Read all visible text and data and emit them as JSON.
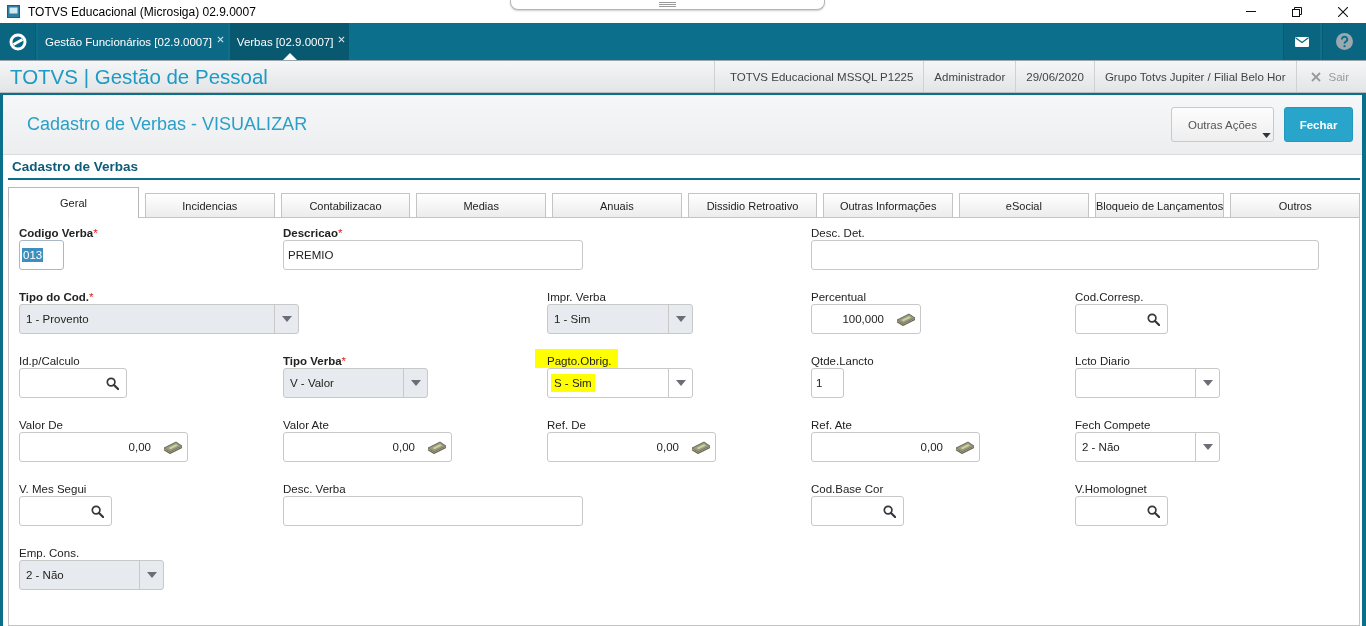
{
  "window": {
    "title": "TOTVS Educacional (Microsiga) 02.9.0007"
  },
  "app_tabs": [
    {
      "label": "Gestão Funcionários [02.9.0007]",
      "selected": false
    },
    {
      "label": "Verbas [02.9.0007]",
      "selected": true
    }
  ],
  "header": {
    "title": "TOTVS | Gestão de Pessoal",
    "info": [
      "TOTVS Educacional MSSQL P1225",
      "Administrador",
      "29/06/2020",
      "Grupo Totvs Jupiter / Filial Belo Hor"
    ],
    "exit": {
      "label": "Sair",
      "disabled": true
    }
  },
  "page": {
    "title": "Cadastro de Verbas - VISUALIZAR",
    "buttons": [
      {
        "label": "Outras Ações",
        "kind": "menu"
      },
      {
        "label": "Fechar",
        "kind": "primary"
      }
    ]
  },
  "section_title": "Cadastro de Verbas",
  "form_tabs": [
    {
      "label": "Geral",
      "selected": true
    },
    {
      "label": "Incidencias",
      "selected": false
    },
    {
      "label": "Contabilizacao",
      "selected": false
    },
    {
      "label": "Medias",
      "selected": false
    },
    {
      "label": "Anuais",
      "selected": false
    },
    {
      "label": "Dissidio Retroativo",
      "selected": false
    },
    {
      "label": "Outras Informações",
      "selected": false
    },
    {
      "label": "eSocial",
      "selected": false
    },
    {
      "label": "Bloqueio de Lançamentos",
      "selected": false
    },
    {
      "label": "Outros",
      "selected": false
    }
  ],
  "form": {
    "rows": [
      [
        {
          "label": "Codigo Verba",
          "required_mark": "*",
          "kind": "text",
          "value": "013",
          "disabled": false,
          "focused": true,
          "highlighted": false
        },
        {
          "label": "Descricao",
          "required_mark": "*",
          "kind": "text",
          "value": "PREMIO",
          "disabled": false,
          "focused": false,
          "highlighted": false
        },
        {
          "label": "Desc. Det.",
          "kind": "text",
          "disabled": false,
          "focused": false,
          "highlighted": false
        }
      ],
      [
        {
          "label": "Tipo do Cod.",
          "required_mark": "*",
          "kind": "select",
          "value": "1 - Provento",
          "disabled": true,
          "focused": false,
          "highlighted": false
        },
        {
          "label": "Impr. Verba",
          "kind": "select",
          "value": "1 - Sim",
          "disabled": true,
          "focused": false,
          "highlighted": false
        },
        {
          "label": "Percentual",
          "kind": "amount",
          "value": "100,000",
          "disabled": false,
          "focused": false,
          "highlighted": false
        },
        {
          "label": "Cod.Corresp.",
          "kind": "lookup",
          "disabled": false,
          "focused": false,
          "highlighted": false
        }
      ],
      [
        {
          "label": "Id.p/Calculo",
          "kind": "lookup",
          "disabled": false,
          "focused": false,
          "highlighted": false
        },
        {
          "label": "Tipo Verba",
          "required_mark": "*",
          "kind": "select",
          "value": "V - Valor",
          "disabled": true,
          "focused": false,
          "highlighted": false
        },
        {
          "label": "Pagto.Obrig.",
          "kind": "select",
          "value": "S - Sim",
          "disabled": false,
          "focused": false,
          "highlighted": true
        },
        {
          "label": "Qtde.Lancto",
          "kind": "text",
          "value": "1",
          "disabled": false,
          "focused": false,
          "highlighted": false
        },
        {
          "label": "Lcto Diario",
          "kind": "select",
          "disabled": false,
          "focused": false,
          "highlighted": false
        }
      ],
      [
        {
          "label": "Valor De",
          "kind": "amount",
          "value": "0,00",
          "disabled": false,
          "focused": false,
          "highlighted": false
        },
        {
          "label": "Valor Ate",
          "kind": "amount",
          "value": "0,00",
          "disabled": false,
          "focused": false,
          "highlighted": false
        },
        {
          "label": "Ref. De",
          "kind": "amount",
          "value": "0,00",
          "disabled": false,
          "focused": false,
          "highlighted": false
        },
        {
          "label": "Ref. Ate",
          "kind": "amount",
          "value": "0,00",
          "disabled": false,
          "focused": false,
          "highlighted": false
        },
        {
          "label": "Fech Compete",
          "kind": "select",
          "value": "2 - Não",
          "disabled": false,
          "focused": false,
          "highlighted": false
        }
      ],
      [
        {
          "label": "V. Mes Segui",
          "kind": "lookup",
          "disabled": false,
          "focused": false,
          "highlighted": false
        },
        {
          "label": "Desc. Verba",
          "kind": "text",
          "disabled": false,
          "focused": false,
          "highlighted": false
        },
        {
          "label": "Cod.Base Cor",
          "kind": "lookup",
          "disabled": false,
          "focused": false,
          "highlighted": false
        },
        {
          "label": "V.Homolognet",
          "kind": "lookup",
          "disabled": false,
          "focused": false,
          "highlighted": false
        }
      ],
      [
        {
          "label": "Emp. Cons.",
          "kind": "select",
          "value": "2 - Não",
          "disabled": true,
          "focused": false,
          "highlighted": false
        }
      ]
    ]
  }
}
